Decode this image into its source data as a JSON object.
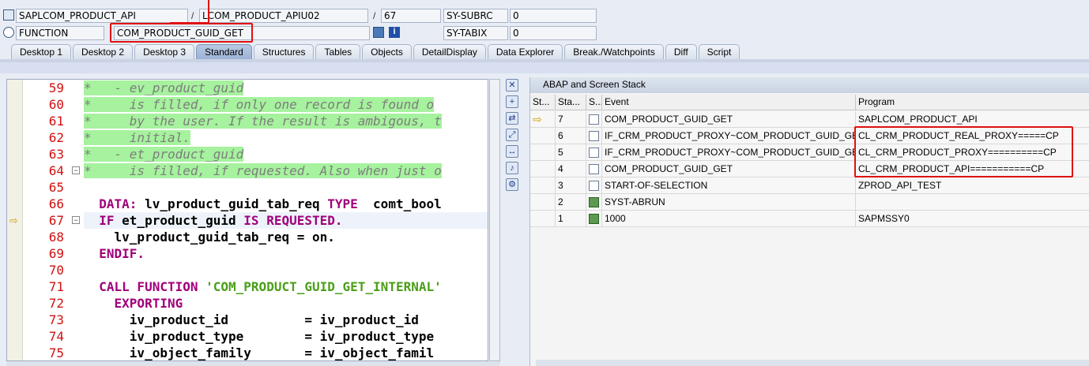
{
  "header": {
    "program": "SAPLCOM_PRODUCT_API",
    "include": "LCOM_PRODUCT_APIU02",
    "line": "67",
    "subrc_label": "SY-SUBRC",
    "subrc_value": "0",
    "event_type": "FUNCTION",
    "event_name": "COM_PRODUCT_GUID_GET",
    "tabix_label": "SY-TABIX",
    "tabix_value": "0",
    "sep1": "/",
    "sep2": "/"
  },
  "tabs": [
    "Desktop 1",
    "Desktop 2",
    "Desktop 3",
    "Standard",
    "Structures",
    "Tables",
    "Objects",
    "DetailDisplay",
    "Data Explorer",
    "Break./Watchpoints",
    "Diff",
    "Script"
  ],
  "active_tab": "Standard",
  "editor": {
    "lines": [
      {
        "no": "59",
        "text": "*   - ev_product_guid"
      },
      {
        "no": "60",
        "text": "*     is filled, if only one record is found o"
      },
      {
        "no": "61",
        "text": "*     by the user. If the result is ambigous, t"
      },
      {
        "no": "62",
        "text": "*     initial."
      },
      {
        "no": "63",
        "text": "*   - et_product_guid"
      },
      {
        "no": "64",
        "text": "*     is filled, if requested. Also when just o"
      },
      {
        "no": "65",
        "text": ""
      },
      {
        "no": "66",
        "kw": "  DATA: ",
        "rest": "lv_product_guid_tab_req ",
        "kw2": "TYPE",
        "rest2": "  comt_bool"
      },
      {
        "no": "67",
        "kw": "  IF ",
        "rest": "et_product_guid ",
        "kw2": "IS REQUESTED.",
        "rest2": ""
      },
      {
        "no": "68",
        "kw": "",
        "rest": "    lv_product_guid_tab_req = on.",
        "kw2": "",
        "rest2": ""
      },
      {
        "no": "69",
        "kw": "  ENDIF.",
        "rest": "",
        "kw2": "",
        "rest2": ""
      },
      {
        "no": "70",
        "text": ""
      },
      {
        "no": "71",
        "kw": "  CALL FUNCTION ",
        "str": "'COM_PRODUCT_GUID_GET_INTERNAL'"
      },
      {
        "no": "72",
        "kw": "    EXPORTING",
        "rest": "",
        "kw2": "",
        "rest2": ""
      },
      {
        "no": "73",
        "kw": "",
        "rest": "      iv_product_id          = iv_product_id",
        "kw2": "",
        "rest2": ""
      },
      {
        "no": "74",
        "kw": "",
        "rest": "      iv_product_type        = iv_product_type",
        "kw2": "",
        "rest2": ""
      },
      {
        "no": "75",
        "kw": "",
        "rest": "      iv_object_family       = iv_object_famil",
        "kw2": "",
        "rest2": ""
      }
    ]
  },
  "stack_panel": {
    "title": "ABAP and Screen Stack",
    "columns": [
      "St...",
      "Sta...",
      "S...",
      "Event",
      "Program"
    ],
    "rows": [
      {
        "level": "7",
        "event": "COM_PRODUCT_GUID_GET",
        "program": "SAPLCOM_PRODUCT_API",
        "current": true,
        "icon": "abap"
      },
      {
        "level": "6",
        "event": "IF_CRM_PRODUCT_PROXY~COM_PRODUCT_GUID_GET",
        "program": "CL_CRM_PRODUCT_REAL_PROXY=====CP",
        "current": false,
        "icon": "abap"
      },
      {
        "level": "5",
        "event": "IF_CRM_PRODUCT_PROXY~COM_PRODUCT_GUID_GET",
        "program": "CL_CRM_PRODUCT_PROXY==========CP",
        "current": false,
        "icon": "abap"
      },
      {
        "level": "4",
        "event": "COM_PRODUCT_GUID_GET",
        "program": "CL_CRM_PRODUCT_API===========CP",
        "current": false,
        "icon": "abap"
      },
      {
        "level": "3",
        "event": "START-OF-SELECTION",
        "program": "ZPROD_API_TEST",
        "current": false,
        "icon": "abap"
      },
      {
        "level": "2",
        "event": "SYST-ABRUN",
        "program": "",
        "current": false,
        "icon": "screen"
      },
      {
        "level": "1",
        "event": "1000",
        "program": "SAPMSSY0",
        "current": false,
        "icon": "screen"
      }
    ]
  },
  "colors": {
    "highlight_border": "#e01010",
    "comment_bg": "#a6f29e",
    "keyword": "#a0007a",
    "line_number": "#d01010"
  }
}
